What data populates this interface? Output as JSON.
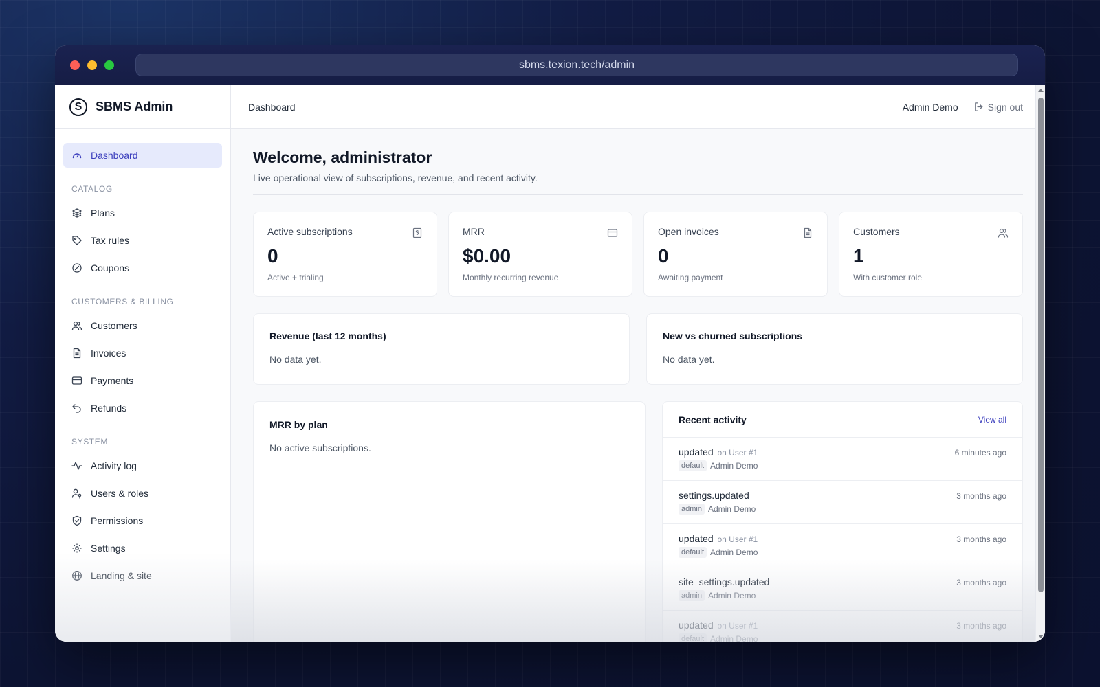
{
  "browser": {
    "url": "sbms.texion.tech/admin"
  },
  "sidebar": {
    "brand": "SBMS Admin",
    "brand_logo_glyph": "S",
    "dashboard": {
      "label": "Dashboard",
      "icon": "gauge-icon"
    },
    "sections": {
      "catalog": "CATALOG",
      "billing": "CUSTOMERS & BILLING",
      "system": "SYSTEM"
    },
    "catalog_items": [
      {
        "label": "Plans",
        "icon": "layers-icon"
      },
      {
        "label": "Tax rules",
        "icon": "tag-icon"
      },
      {
        "label": "Coupons",
        "icon": "percent-badge-icon"
      }
    ],
    "billing_items": [
      {
        "label": "Customers",
        "icon": "users-icon"
      },
      {
        "label": "Invoices",
        "icon": "document-icon"
      },
      {
        "label": "Payments",
        "icon": "credit-card-icon"
      },
      {
        "label": "Refunds",
        "icon": "undo-icon"
      }
    ],
    "system_items": [
      {
        "label": "Activity log",
        "icon": "activity-icon"
      },
      {
        "label": "Users & roles",
        "icon": "user-key-icon"
      },
      {
        "label": "Permissions",
        "icon": "shield-check-icon"
      },
      {
        "label": "Settings",
        "icon": "gear-icon"
      },
      {
        "label": "Landing & site",
        "icon": "globe-icon"
      }
    ]
  },
  "topbar": {
    "breadcrumb": "Dashboard",
    "user": "Admin Demo",
    "signout": "Sign out"
  },
  "welcome": {
    "title": "Welcome, administrator",
    "subtitle": "Live operational view of subscriptions, revenue, and recent activity."
  },
  "stats": [
    {
      "label": "Active subscriptions",
      "value": "0",
      "hint": "Active + trialing",
      "icon": "dollar-doc-icon"
    },
    {
      "label": "MRR",
      "value": "$0.00",
      "hint": "Monthly recurring revenue",
      "icon": "credit-card-icon"
    },
    {
      "label": "Open invoices",
      "value": "0",
      "hint": "Awaiting payment",
      "icon": "document-icon"
    },
    {
      "label": "Customers",
      "value": "1",
      "hint": "With customer role",
      "icon": "users-icon"
    }
  ],
  "cards": {
    "revenue": {
      "title": "Revenue (last 12 months)",
      "empty": "No data yet."
    },
    "churn": {
      "title": "New vs churned subscriptions",
      "empty": "No data yet."
    },
    "mrr_by_plan": {
      "title": "MRR by plan",
      "empty": "No active subscriptions."
    }
  },
  "activity": {
    "title": "Recent activity",
    "view_all": "View all",
    "items": [
      {
        "action": "updated",
        "target": "on User #1",
        "time": "6 minutes ago",
        "tag": "default",
        "user": "Admin Demo"
      },
      {
        "action": "settings.updated",
        "target": "",
        "time": "3 months ago",
        "tag": "admin",
        "user": "Admin Demo"
      },
      {
        "action": "updated",
        "target": "on User #1",
        "time": "3 months ago",
        "tag": "default",
        "user": "Admin Demo"
      },
      {
        "action": "site_settings.updated",
        "target": "",
        "time": "3 months ago",
        "tag": "admin",
        "user": "Admin Demo"
      },
      {
        "action": "updated",
        "target": "on User #1",
        "time": "3 months ago",
        "tag": "default",
        "user": "Admin Demo"
      }
    ]
  },
  "colors": {
    "accent": "#3b3ebd",
    "active_nav_bg": "#e6eafc"
  }
}
